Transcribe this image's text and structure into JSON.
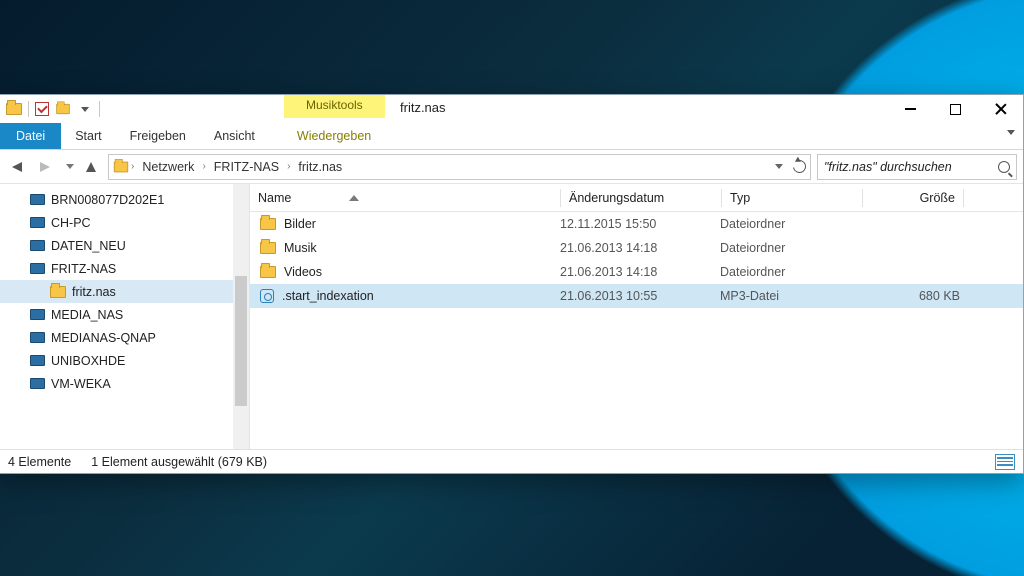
{
  "window": {
    "contextual_tab_group": "Musiktools",
    "title_location": "fritz.nas"
  },
  "ribbon": {
    "file": "Datei",
    "tabs": [
      "Start",
      "Freigeben",
      "Ansicht"
    ],
    "contextual": "Wiedergeben"
  },
  "address": {
    "crumbs": [
      "Netzwerk",
      "FRITZ-NAS",
      "fritz.nas"
    ]
  },
  "search": {
    "placeholder": "\"fritz.nas\" durchsuchen"
  },
  "tree": {
    "items": [
      {
        "label": "BRN008077D202E1",
        "kind": "computer",
        "depth": 0
      },
      {
        "label": "CH-PC",
        "kind": "computer",
        "depth": 0
      },
      {
        "label": "DATEN_NEU",
        "kind": "computer",
        "depth": 0
      },
      {
        "label": "FRITZ-NAS",
        "kind": "computer",
        "depth": 0
      },
      {
        "label": "fritz.nas",
        "kind": "folder",
        "depth": 1,
        "selected": true
      },
      {
        "label": "MEDIA_NAS",
        "kind": "computer",
        "depth": 0
      },
      {
        "label": "MEDIANAS-QNAP",
        "kind": "computer",
        "depth": 0
      },
      {
        "label": "UNIBOXHDE",
        "kind": "computer",
        "depth": 0
      },
      {
        "label": "VM-WEKA",
        "kind": "computer",
        "depth": 0
      }
    ]
  },
  "columns": {
    "name": "Name",
    "date": "Änderungsdatum",
    "type": "Typ",
    "size": "Größe"
  },
  "rows": [
    {
      "name": "Bilder",
      "date": "12.11.2015 15:50",
      "type": "Dateiordner",
      "size": "",
      "icon": "folder"
    },
    {
      "name": "Musik",
      "date": "21.06.2013 14:18",
      "type": "Dateiordner",
      "size": "",
      "icon": "folder"
    },
    {
      "name": "Videos",
      "date": "21.06.2013 14:18",
      "type": "Dateiordner",
      "size": "",
      "icon": "folder"
    },
    {
      "name": ".start_indexation",
      "date": "21.06.2013 10:55",
      "type": "MP3-Datei",
      "size": "680 KB",
      "icon": "music",
      "selected": true
    }
  ],
  "status": {
    "count": "4 Elemente",
    "selection": "1 Element ausgewählt (679 KB)"
  }
}
